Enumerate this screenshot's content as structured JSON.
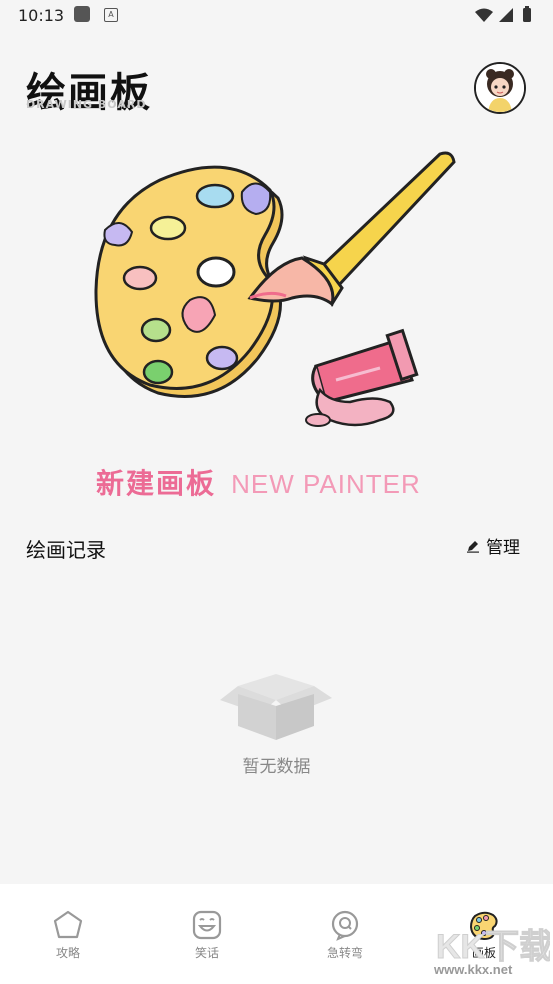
{
  "status_bar": {
    "time": "10:13",
    "app_badge": "A"
  },
  "header": {
    "title": "绘画板",
    "subtitle": "DRAWING BOARD"
  },
  "new_painter": {
    "label_zh": "新建画板",
    "label_en": "NEW PAINTER"
  },
  "records": {
    "title": "绘画记录",
    "manage_label": "管理",
    "empty_text": "暂无数据"
  },
  "tabbar": {
    "tabs": [
      {
        "label": "攻略",
        "icon": "pentagon-icon",
        "active": false
      },
      {
        "label": "笑话",
        "icon": "smile-face-icon",
        "active": false
      },
      {
        "label": "急转弯",
        "icon": "question-bubble-icon",
        "active": false
      },
      {
        "label": "画板",
        "icon": "palette-icon",
        "active": true
      }
    ]
  },
  "watermark": {
    "brand": "KK下载",
    "url": "www.kkx.net"
  },
  "colors": {
    "accent_pink": "#ec6b95",
    "palette_yellow": "#f9d572",
    "tube_pink": "#ef6c8c"
  }
}
